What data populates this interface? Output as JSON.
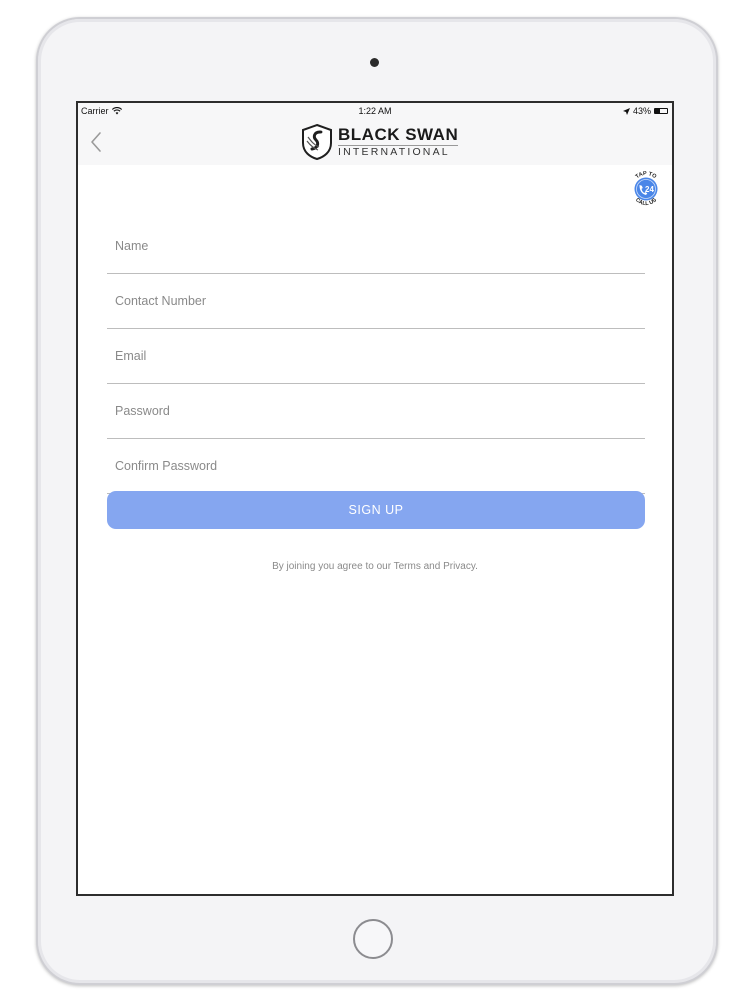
{
  "status_bar": {
    "carrier": "Carrier",
    "time": "1:22 AM",
    "battery": "43%",
    "battery_level": 0.43
  },
  "header": {
    "back_icon": "chevron-left-icon",
    "logo_icon": "swan-shield-icon",
    "logo_title": "BLACK SWAN",
    "logo_subtitle": "INTERNATIONAL"
  },
  "call_badge": {
    "icon": "phone-24-icon",
    "top_text": "TAP TO",
    "number": "24",
    "bottom_text": "CALL US",
    "color": "#4a86e8"
  },
  "form": {
    "fields": [
      {
        "placeholder": "Name",
        "value": ""
      },
      {
        "placeholder": "Contact Number",
        "value": ""
      },
      {
        "placeholder": "Email",
        "value": ""
      },
      {
        "placeholder": "Password",
        "value": ""
      },
      {
        "placeholder": "Confirm Password",
        "value": ""
      }
    ],
    "submit_label": "SIGN UP",
    "submit_color": "#85a6f0",
    "terms_text": "By joining you agree to our Terms and Privacy."
  }
}
